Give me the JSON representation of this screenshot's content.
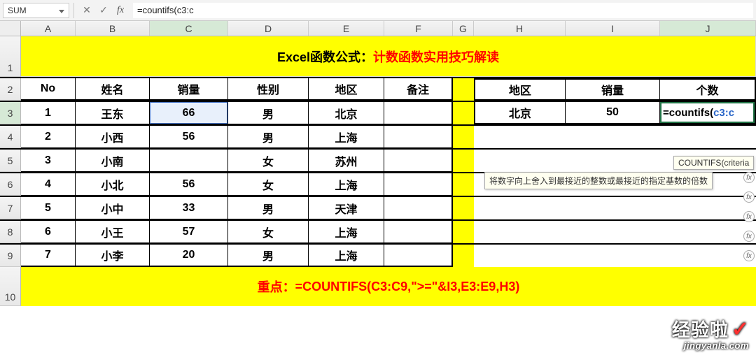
{
  "formula_bar": {
    "name_box": "SUM",
    "cancel_glyph": "✕",
    "enter_glyph": "✓",
    "fx_glyph": "fx",
    "input": "=countifs(c3:c"
  },
  "columns": [
    "A",
    "B",
    "C",
    "D",
    "E",
    "F",
    "G",
    "H",
    "I",
    "J"
  ],
  "title": {
    "black": "Excel函数公式：",
    "red": "计数函数实用技巧解读"
  },
  "headers_left": {
    "no": "No",
    "name": "姓名",
    "sales": "销量",
    "gender": "性别",
    "region": "地区",
    "remark": "备注"
  },
  "headers_right": {
    "region": "地区",
    "sales": "销量",
    "count": "个数"
  },
  "rows": [
    {
      "no": "1",
      "name": "王东",
      "sales": "66",
      "gender": "男",
      "region": "北京"
    },
    {
      "no": "2",
      "name": "小西",
      "sales": "56",
      "gender": "男",
      "region": "上海"
    },
    {
      "no": "3",
      "name": "小南",
      "sales": "",
      "gender": "女",
      "region": "苏州"
    },
    {
      "no": "4",
      "name": "小北",
      "sales": "56",
      "gender": "女",
      "region": "上海"
    },
    {
      "no": "5",
      "name": "小中",
      "sales": "33",
      "gender": "男",
      "region": "天津"
    },
    {
      "no": "6",
      "name": "小王",
      "sales": "57",
      "gender": "女",
      "region": "上海"
    },
    {
      "no": "7",
      "name": "小李",
      "sales": "20",
      "gender": "男",
      "region": "上海"
    }
  ],
  "right_row": {
    "region": "北京",
    "sales": "50"
  },
  "editing": {
    "prefix": "=",
    "fn": "countifs(",
    "range": "c3:c"
  },
  "tooltip_func": "COUNTIFS(criteria",
  "tooltip_ceil": "将数字向上舍入到最接近的整数或最接近的指定基数的倍数",
  "bottom": {
    "label": "重点：",
    "formula": "=COUNTIFS(C3:C9,\">=\"&I3,E3:E9,H3)"
  },
  "watermark": {
    "big": "经验啦",
    "check": "✓",
    "small": "jingyanla.com"
  },
  "row_labels": [
    "1",
    "2",
    "3",
    "4",
    "5",
    "6",
    "7",
    "8",
    "9",
    "10"
  ]
}
